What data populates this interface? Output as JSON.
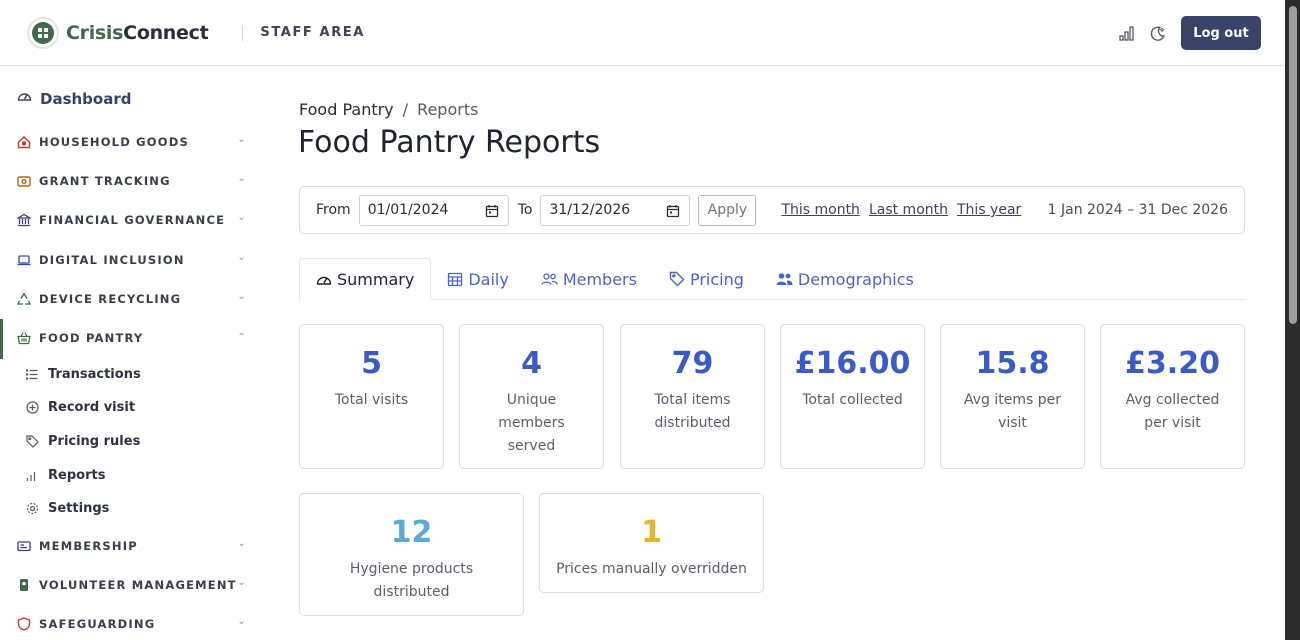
{
  "header": {
    "brand_part1": "Crisis",
    "brand_part2": "Connect",
    "area": "STAFF AREA",
    "logout_label": "Log out",
    "icons": [
      "signal-icon",
      "moon-icon"
    ]
  },
  "sidebar": {
    "dashboard_label": "Dashboard",
    "sections": [
      {
        "label": "HOUSEHOLD GOODS",
        "icon": "house-icon",
        "expanded": false
      },
      {
        "label": "GRANT TRACKING",
        "icon": "wallet-icon",
        "expanded": false
      },
      {
        "label": "FINANCIAL GOVERNANCE",
        "icon": "bank-icon",
        "expanded": false
      },
      {
        "label": "DIGITAL INCLUSION",
        "icon": "laptop-icon",
        "expanded": false
      },
      {
        "label": "DEVICE RECYCLING",
        "icon": "recycle-icon",
        "expanded": false
      },
      {
        "label": "FOOD PANTRY",
        "icon": "basket-icon",
        "expanded": true
      },
      {
        "label": "MEMBERSHIP",
        "icon": "id-card-icon",
        "expanded": false
      },
      {
        "label": "VOLUNTEER MANAGEMENT",
        "icon": "badge-icon",
        "expanded": false
      },
      {
        "label": "SAFEGUARDING",
        "icon": "shield-icon",
        "expanded": false
      }
    ],
    "food_pantry_items": [
      {
        "label": "Transactions",
        "icon": "list-icon"
      },
      {
        "label": "Record visit",
        "icon": "plus-circle-icon"
      },
      {
        "label": "Pricing rules",
        "icon": "tags-icon"
      },
      {
        "label": "Reports",
        "icon": "bar-chart-icon"
      },
      {
        "label": "Settings",
        "icon": "gear-icon"
      }
    ]
  },
  "breadcrumb": {
    "parent": "Food Pantry",
    "separator": "/",
    "current": "Reports"
  },
  "page_title": "Food Pantry Reports",
  "filter": {
    "from_label": "From",
    "from_value": "01/01/2024",
    "to_label": "To",
    "to_value": "31/12/2026",
    "apply_label": "Apply",
    "quick_links": [
      "This month",
      "Last month",
      "This year"
    ],
    "range_text": "1 Jan 2024 – 31 Dec 2026"
  },
  "tabs": [
    {
      "label": "Summary",
      "icon": "gauge-icon",
      "active": true
    },
    {
      "label": "Daily",
      "icon": "calendar-icon",
      "active": false
    },
    {
      "label": "Members",
      "icon": "people-icon",
      "active": false
    },
    {
      "label": "Pricing",
      "icon": "tag-icon",
      "active": false
    },
    {
      "label": "Demographics",
      "icon": "users-icon",
      "active": false
    }
  ],
  "stats": [
    {
      "value": "5",
      "label": "Total visits",
      "color": "#3a5bc7"
    },
    {
      "value": "4",
      "label": "Unique members served",
      "color": "#3a5bc7"
    },
    {
      "value": "79",
      "label": "Total items distributed",
      "color": "#3a5bc7"
    },
    {
      "value": "£16.00",
      "label": "Total collected",
      "color": "#3a5bc7"
    },
    {
      "value": "15.8",
      "label": "Avg items per visit",
      "color": "#3a5bc7"
    },
    {
      "value": "£3.20",
      "label": "Avg collected per visit",
      "color": "#3a5bc7"
    },
    {
      "value": "12",
      "label": "Hygiene products distributed",
      "color": "#5aa9d6"
    },
    {
      "value": "1",
      "label": "Prices manually overridden",
      "color": "#e5b52e"
    }
  ],
  "colors": {
    "brand_green": "#3f6a4c",
    "primary": "#3a4268",
    "link": "#4b64c4"
  }
}
